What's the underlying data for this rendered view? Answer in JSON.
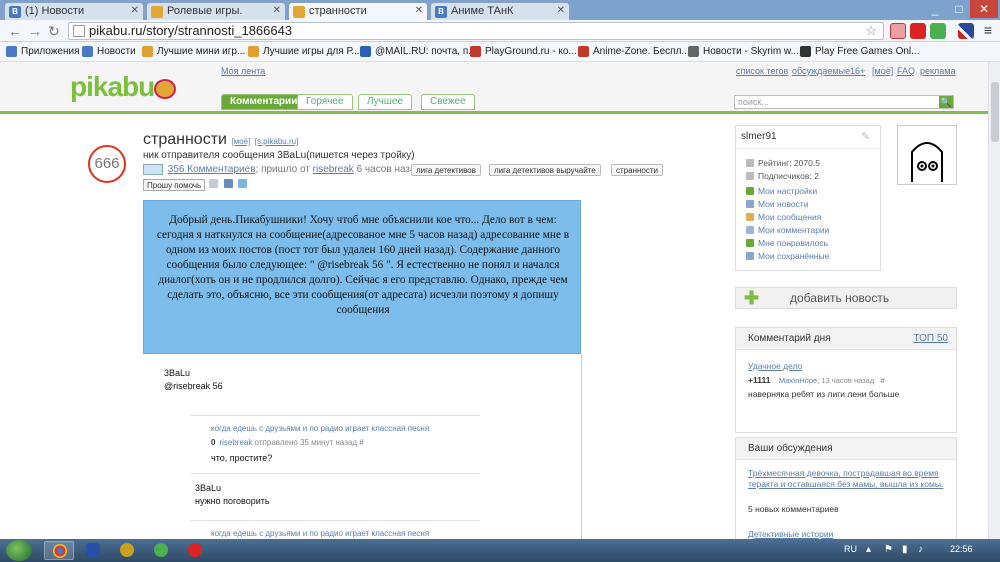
{
  "browser": {
    "tabs": [
      {
        "label": "(1) Новости",
        "icon": "vk-icon",
        "active": false
      },
      {
        "label": "Ролевые игры.",
        "icon": "pikabu-icon",
        "active": false
      },
      {
        "label": "странности",
        "icon": "pikabu-icon",
        "active": true
      },
      {
        "label": "Аниме ТАнК",
        "icon": "vk-icon",
        "active": false
      }
    ],
    "url": "pikabu.ru/story/strannosti_1866643",
    "bookmarks": [
      {
        "label": "Приложения",
        "color": "#4a78c5"
      },
      {
        "label": "Новости",
        "color": "#4a78c5"
      },
      {
        "label": "Лучшие мини игр...",
        "color": "#e0a030"
      },
      {
        "label": "Лучшие игры для Р...",
        "color": "#e0a030"
      },
      {
        "label": "@MAIL.RU: почта, п...",
        "color": "#2a62b8"
      },
      {
        "label": "PlayGround.ru - ко...",
        "color": "#c0392b"
      },
      {
        "label": "Anime-Zone. Беспл...",
        "color": "#c0392b"
      },
      {
        "label": "Новости - Skyrim w...",
        "color": "#666666"
      },
      {
        "label": "Play Free Games Onl...",
        "color": "#333333"
      }
    ]
  },
  "site": {
    "logo": "pikabu",
    "my_feed": "Моя лента",
    "top_links": [
      "список тегов",
      "обсуждаемые",
      "16+",
      "[моё]",
      "FAQ",
      "реклама"
    ],
    "nav_tabs": [
      "Комментарии",
      "Горячее",
      "Лучшее",
      "Свежее"
    ],
    "search_placeholder": "поиск..."
  },
  "story": {
    "rating": "666",
    "title": "странности",
    "meta_links": [
      "[моё]",
      "[s.pikabu.ru]"
    ],
    "subtitle": "ник отправителя сообщения 3BaLu(пишется через тройку)",
    "comments_link": "356 Комментариев",
    "posted_text": "; пришло от",
    "author": "risebreak",
    "time": "6 часов назад",
    "tags": [
      "лига детективов",
      "лига детективов выручайте",
      "странности"
    ],
    "help_button": "Прошу помочь",
    "body": "Добрый день.Пикабушники! Хочу чтоб мне объяснили кое что...    Дело вот в чем: сегодня я наткнулся на сообщение(адресованое мне 5 часов назад)   адресование мне в одном из моих постов (пост тот был удален 160 дней назад). Содержание данного сообщения было следующее: \" @risebreak 56 \". Я естественно не понял и начался диалог(хоть он и не продлился долго). Сейчас я его представлю. Однако, прежде чем сделать это, объясню, все эти сообщения(от адресата) исчезли поэтому я допишу сообщения"
  },
  "thread": [
    {
      "author": "3BaLu",
      "text": "@risebreak 56"
    },
    {
      "ref": "когда едешь с друзьями и по радио играет классная песня",
      "score": "0",
      "user": "risebreak",
      "sent": "отправлено 35 минут назад",
      "hash": "#",
      "text": "что, простите?"
    },
    {
      "author": "3BaLu",
      "text": "нужно поговорить"
    },
    {
      "ref": "когда едешь с друзьями и по радио играет классная песня"
    }
  ],
  "sidebar": {
    "username": "slmer91",
    "rating": "Рейтинг: 2070.5",
    "subscribers": "Подписчиков: 2",
    "links": [
      "Мои настройки",
      "Мои новости",
      "Мои сообщения",
      "Мои комментарии",
      "Мне понравилось",
      "Мои сохранённые"
    ],
    "add_news": "добавить новость",
    "comment_of_day": {
      "title": "Комментарий дня",
      "top": "ТОП 50",
      "post": "Удачное дело",
      "score": "+1111",
      "user": "MaxInHope",
      "time": "; 13 часов назад",
      "hash": "#",
      "text": "наверняка ребят из лиги лени больше"
    },
    "discussions": {
      "title": "Ваши обсуждения",
      "item": "Трёхмесячная девочка, пострадавшая во время теракта и оставшаяся без мамы, вышла из комы.",
      "comments": "5 новых комментариев",
      "next": "Детективные истории"
    }
  },
  "taskbar": {
    "lang": "RU",
    "clock": "22:56"
  }
}
